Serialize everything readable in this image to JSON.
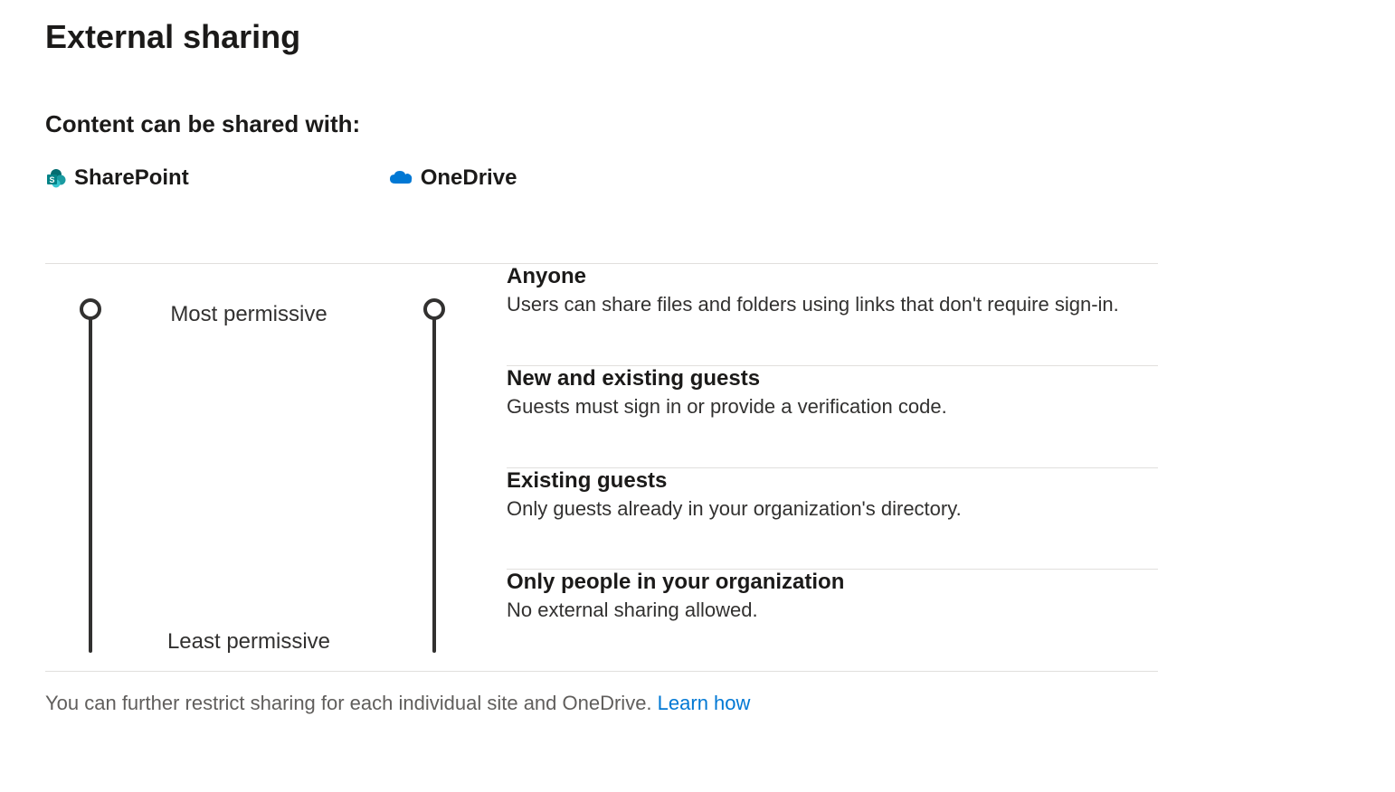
{
  "page": {
    "title": "External sharing",
    "subtitle": "Content can be shared with:"
  },
  "services": {
    "sharepoint": "SharePoint",
    "onedrive": "OneDrive"
  },
  "labels": {
    "most_permissive": "Most permissive",
    "least_permissive": "Least permissive"
  },
  "options": [
    {
      "title": "Anyone",
      "desc": "Users can share files and folders using links that don't require sign-in."
    },
    {
      "title": "New and existing guests",
      "desc": "Guests must sign in or provide a verification code."
    },
    {
      "title": "Existing guests",
      "desc": "Only guests already in your organization's directory."
    },
    {
      "title": "Only people in your organization",
      "desc": "No external sharing allowed."
    }
  ],
  "footer": {
    "text": "You can further restrict sharing for each individual site and OneDrive. ",
    "link": "Learn how"
  }
}
